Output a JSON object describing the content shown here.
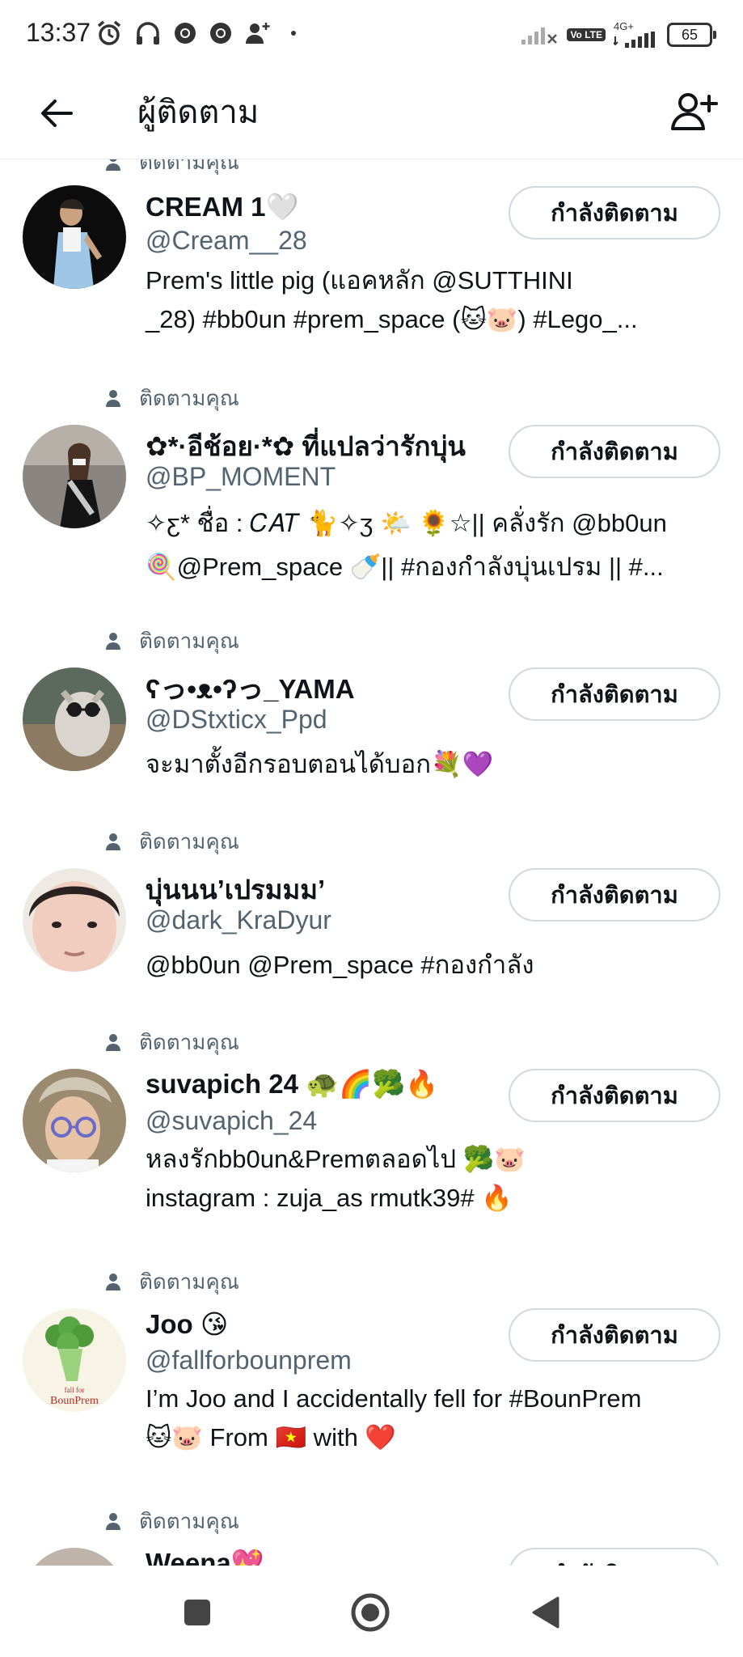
{
  "status_bar": {
    "time": "13:37",
    "network": "4G+",
    "volte": "Vo LTE",
    "battery": "65"
  },
  "header": {
    "title": "ผู้ติดตาม"
  },
  "follows_you_label": "ติดตามคุณ",
  "following_button_label": "กำลังติดตาม",
  "followers": [
    {
      "display_name": "CREAM 1🤍",
      "handle": "@Cream__28",
      "bio_lines": [
        "Prem's little pig (แอคหลัก @SUTTHINI",
        "_28) #bb0un #prem_space (🐱🐷) #Lego_..."
      ]
    },
    {
      "display_name": "✿*·อีช้อย·*✿ ที่แปลว่ารักบุ่น",
      "handle": "@BP_MOMENT",
      "bio_lines": [
        "✧ƹ* ชื่อ : 𝐶𝐴𝑇 🐈✧ʒ 🌤️ 🌻☆|| คลั่งรัก @bb0un",
        "🍭@Prem_space 🍼|| #กองกำลังบุ่นเปรม || #..."
      ]
    },
    {
      "display_name": "ʕっ•ᴥ•ʔっ_YAMA",
      "handle": "@DStxticx_Ppd",
      "bio_lines": [
        "จะมาตั้งอีกรอบตอนได้บอก💐💜"
      ]
    },
    {
      "display_name": "บุ่นนน’เปรมมม’",
      "handle": "@dark_KraDyur",
      "bio_lines": [
        "@bb0un @Prem_space  #กองกำลัง"
      ]
    },
    {
      "display_name": "suvapich 24 🐢🌈🥦🔥",
      "handle": "@suvapich_24",
      "bio_lines": [
        "หลงรักbb0un&Premตลอดไป 🥦🐷",
        "instagram : zuja_as rmutk39# 🔥"
      ]
    },
    {
      "display_name": "Joo 😘",
      "handle": "@fallforbounprem",
      "bio_lines": [
        "I’m Joo and I accidentally fell for #BounPrem",
        "🐱🐷 From 🇻🇳 with ❤️"
      ]
    },
    {
      "display_name": "Weena💖",
      "handle": "",
      "bio_lines": []
    }
  ],
  "avatar_texts": {
    "joo_line1": "fall for",
    "joo_line2": "BounPrem"
  }
}
